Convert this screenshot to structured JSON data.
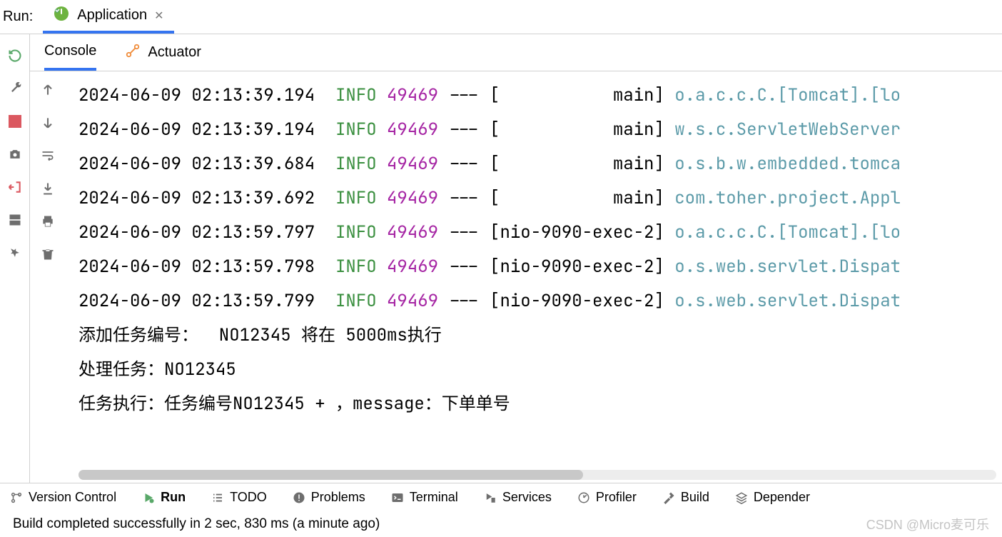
{
  "header": {
    "run_label": "Run:",
    "app_tab_label": "Application"
  },
  "sub_tabs": {
    "console": "Console",
    "actuator": "Actuator"
  },
  "log_lines": [
    {
      "ts": "2024-06-09 02:13:39.194",
      "level": "INFO",
      "pid": "49469",
      "thread": "[           main]",
      "logger": "o.a.c.c.C.[Tomcat].[lo"
    },
    {
      "ts": "2024-06-09 02:13:39.194",
      "level": "INFO",
      "pid": "49469",
      "thread": "[           main]",
      "logger": "w.s.c.ServletWebServer"
    },
    {
      "ts": "2024-06-09 02:13:39.684",
      "level": "INFO",
      "pid": "49469",
      "thread": "[           main]",
      "logger": "o.s.b.w.embedded.tomca"
    },
    {
      "ts": "2024-06-09 02:13:39.692",
      "level": "INFO",
      "pid": "49469",
      "thread": "[           main]",
      "logger": "com.toher.project.Appl"
    },
    {
      "ts": "2024-06-09 02:13:59.797",
      "level": "INFO",
      "pid": "49469",
      "thread": "[nio-9090-exec-2]",
      "logger": "o.a.c.c.C.[Tomcat].[lo"
    },
    {
      "ts": "2024-06-09 02:13:59.798",
      "level": "INFO",
      "pid": "49469",
      "thread": "[nio-9090-exec-2]",
      "logger": "o.s.web.servlet.Dispat"
    },
    {
      "ts": "2024-06-09 02:13:59.799",
      "level": "INFO",
      "pid": "49469",
      "thread": "[nio-9090-exec-2]",
      "logger": "o.s.web.servlet.Dispat"
    }
  ],
  "plain_lines": [
    "添加任务编号：  NO12345 将在 5000ms执行",
    "处理任务：NO12345",
    "任务执行：任务编号NO12345 + ，message：下单单号"
  ],
  "bottom_tabs": {
    "version_control": "Version Control",
    "run": "Run",
    "todo": "TODO",
    "problems": "Problems",
    "terminal": "Terminal",
    "services": "Services",
    "profiler": "Profiler",
    "build": "Build",
    "dependencies": "Depender"
  },
  "status": "Build completed successfully in 2 sec, 830 ms (a minute ago)",
  "watermark": "CSDN @Micro麦可乐"
}
